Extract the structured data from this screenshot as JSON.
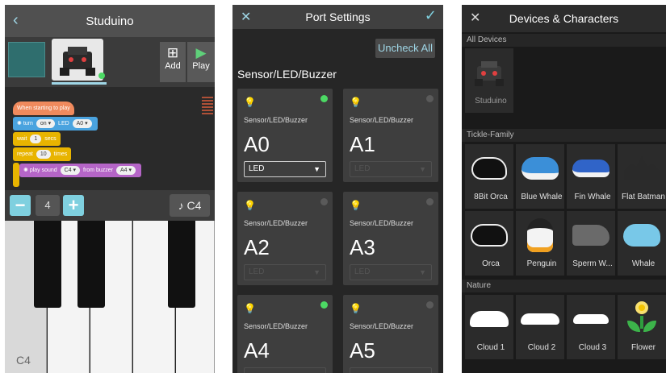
{
  "studuino": {
    "title": "Studuino",
    "add_label": "Add",
    "play_label": "Play",
    "blocks": {
      "start": "When starting to play",
      "turn_word": "turn",
      "turn_state": "on ▾",
      "led_word": "LED",
      "led_port": "A0 ▾",
      "wait_word": "wait",
      "wait_value": "1",
      "secs_word": "secs",
      "repeat_word": "repeat",
      "repeat_value": "10",
      "times_word": "times",
      "play_word": "play sound",
      "note_value": "C4 ▾",
      "from_word": "from buzzer",
      "buzzer_port": "A4 ▾"
    },
    "octave": "4",
    "note_button": "♪ C4",
    "piano_label": "C4"
  },
  "port_settings": {
    "title": "Port Settings",
    "uncheck_all": "Uncheck All",
    "section": "Sensor/LED/Buzzer",
    "ports": [
      {
        "type": "Sensor/LED/Buzzer",
        "name": "A0",
        "select": "LED",
        "active": true
      },
      {
        "type": "Sensor/LED/Buzzer",
        "name": "A1",
        "select": "LED",
        "active": false
      },
      {
        "type": "Sensor/LED/Buzzer",
        "name": "A2",
        "select": "LED",
        "active": false
      },
      {
        "type": "Sensor/LED/Buzzer",
        "name": "A3",
        "select": "LED",
        "active": false
      },
      {
        "type": "Sensor/LED/Buzzer",
        "name": "A4",
        "select": "",
        "active": true
      },
      {
        "type": "Sensor/LED/Buzzer",
        "name": "A5",
        "select": "",
        "active": false
      }
    ]
  },
  "devices": {
    "title": "Devices & Characters",
    "groups": [
      "All Devices",
      "Tickle-Family",
      "Nature"
    ],
    "all_devices": [
      {
        "label": "Studuino"
      }
    ],
    "tickle_family": [
      {
        "label": "8Bit Orca"
      },
      {
        "label": "Blue Whale"
      },
      {
        "label": "Fin Whale"
      },
      {
        "label": "Flat Batman"
      },
      {
        "label": "Orca"
      },
      {
        "label": "Penguin"
      },
      {
        "label": "Sperm W..."
      },
      {
        "label": "Whale"
      }
    ],
    "nature": [
      {
        "label": "Cloud 1"
      },
      {
        "label": "Cloud 2"
      },
      {
        "label": "Cloud 3"
      },
      {
        "label": "Flower"
      }
    ]
  },
  "colors": {
    "accent": "#7fd0df",
    "active_dot": "#4cd964",
    "block_orange": "#f08a5d",
    "block_blue": "#4aa3df",
    "block_yellow": "#e8b400",
    "block_purple": "#b565c7"
  }
}
